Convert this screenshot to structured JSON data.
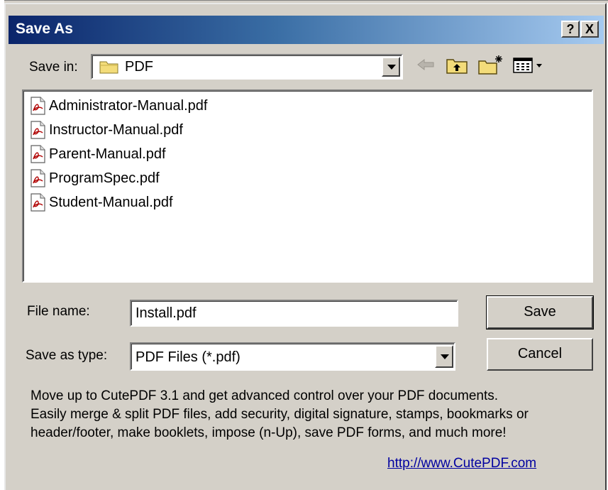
{
  "window": {
    "title": "Save As",
    "help_label": "?",
    "close_label": "X"
  },
  "toolbar": {
    "save_in_label": "Save in:",
    "save_in_value": "PDF",
    "icons": [
      "back-arrow-icon",
      "up-folder-icon",
      "new-folder-icon",
      "view-menu-icon"
    ]
  },
  "files": [
    {
      "name": "Administrator-Manual.pdf"
    },
    {
      "name": "Instructor-Manual.pdf"
    },
    {
      "name": "Parent-Manual.pdf"
    },
    {
      "name": "ProgramSpec.pdf"
    },
    {
      "name": "Student-Manual.pdf"
    }
  ],
  "form": {
    "file_name_label": "File name:",
    "file_name_value": "Install.pdf",
    "save_as_type_label": "Save as type:",
    "save_as_type_value": "PDF Files (*.pdf)"
  },
  "buttons": {
    "save": "Save",
    "cancel": "Cancel"
  },
  "promo": {
    "line1": "Move up to CutePDF 3.1 and get advanced control over your PDF documents.",
    "line2": "Easily merge & split PDF files, add security, digital signature, stamps, bookmarks or",
    "line3": "header/footer, make booklets, impose (n-Up), save PDF forms, and much more!",
    "link": "http://www.CutePDF.com"
  },
  "colors": {
    "titlebar_start": "#0a246a",
    "titlebar_end": "#a6caf0",
    "dialog_bg": "#d4d0c8",
    "link": "#0000a0"
  }
}
